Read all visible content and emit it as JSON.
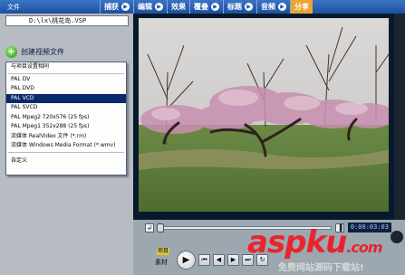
{
  "menubar": {
    "file_label": "文件",
    "items": [
      {
        "label": "捕获"
      },
      {
        "label": "编辑"
      },
      {
        "label": "效果"
      },
      {
        "label": "覆叠"
      },
      {
        "label": "标题"
      },
      {
        "label": "音频"
      },
      {
        "label": "分享"
      }
    ]
  },
  "left_panel": {
    "project_path": "D:\\lx\\桃花岛.VSP",
    "create_video_label": "创建视频文件",
    "dropdown": {
      "header": "与项目设置相同",
      "items": [
        {
          "label": "PAL   DV",
          "selected": false
        },
        {
          "label": "PAL   DVD",
          "selected": false
        },
        {
          "label": "PAL   VCD",
          "selected": true
        },
        {
          "label": "PAL   SVCD",
          "selected": false
        },
        {
          "label": "PAL   Mpeg2 720x576 (25 fps)",
          "selected": false
        },
        {
          "label": "PAL   Mpeg1 352x288 (25 fps)",
          "selected": false
        },
        {
          "label": "流媒体 RealVideo 文件 (*.rm)",
          "selected": false
        },
        {
          "label": "流媒体 Windows Media Format (*.wmv)",
          "selected": false
        }
      ],
      "custom": "自定义"
    }
  },
  "player": {
    "timecode": "0:00:03:03",
    "mode_top": "项目",
    "mode_bottom": "素材"
  },
  "watermark": {
    "brand": "aspku",
    "suffix": ".com",
    "tagline": "免费网站源码下载站!"
  },
  "colors": {
    "menubar": "#1c4f9f",
    "selection": "#0a2a6b",
    "watermark": "#e8242c"
  }
}
